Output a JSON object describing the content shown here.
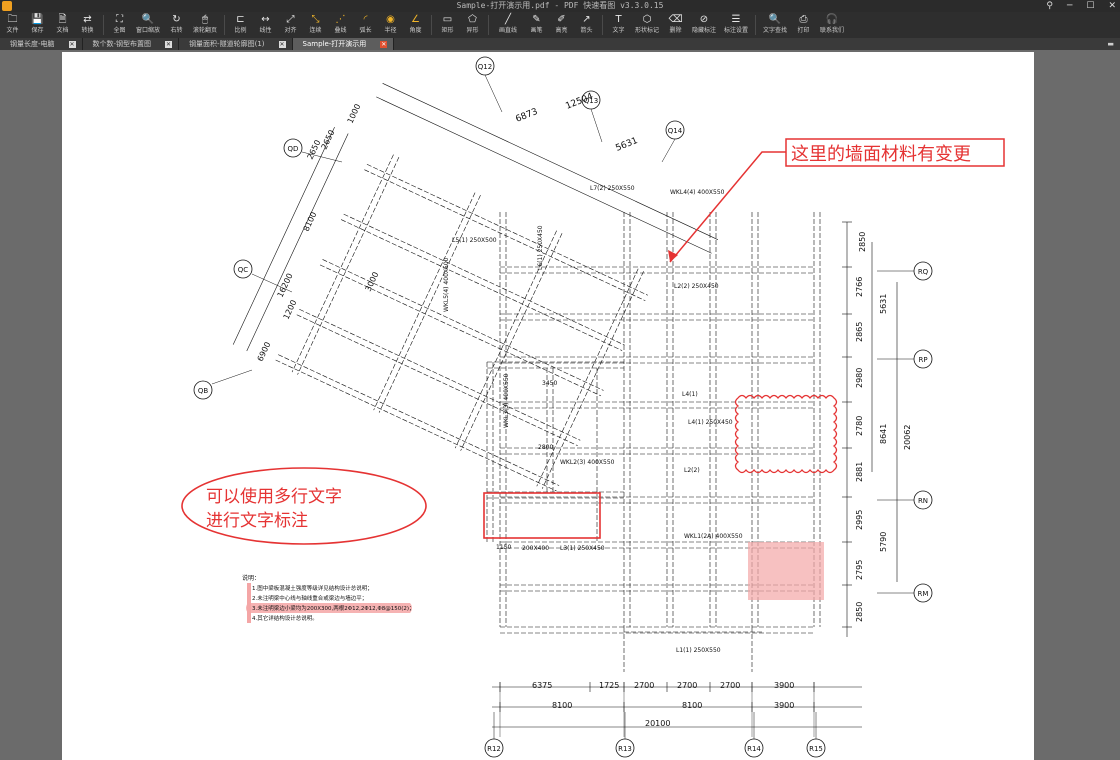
{
  "window": {
    "title": "Sample-打开演示用.pdf - PDF 快速看图 v3.3.0.15",
    "controls": [
      "⚲",
      "─",
      "☐",
      "✕"
    ]
  },
  "toolbar": [
    {
      "label": "文件",
      "icon": "folder-icon",
      "glyph": "🗀"
    },
    {
      "label": "保存",
      "icon": "save-icon",
      "glyph": "💾"
    },
    {
      "label": "文档",
      "icon": "document-icon",
      "glyph": "🗎"
    },
    {
      "label": "转换",
      "icon": "convert-icon",
      "glyph": "⇄"
    },
    {
      "label": "全图",
      "icon": "fit-all-icon",
      "glyph": "⛶"
    },
    {
      "label": "窗口缩放",
      "icon": "zoom-window-icon",
      "glyph": "🔍"
    },
    {
      "label": "右转",
      "icon": "rotate-right-icon",
      "glyph": "↻"
    },
    {
      "label": "滚轮翻页",
      "icon": "mouse-scroll-icon",
      "glyph": "🖱"
    },
    {
      "label": "比例",
      "icon": "scale-icon",
      "glyph": "⊏"
    },
    {
      "label": "线性",
      "icon": "linear-measure-icon",
      "glyph": "↔"
    },
    {
      "label": "对齐",
      "icon": "aligned-measure-icon",
      "glyph": "⤢"
    },
    {
      "label": "连续",
      "icon": "continuous-measure-icon",
      "glyph": "⤡"
    },
    {
      "label": "叠线",
      "icon": "overlay-line-icon",
      "glyph": "⋰"
    },
    {
      "label": "弧长",
      "icon": "arc-length-icon",
      "glyph": "◜"
    },
    {
      "label": "半径",
      "icon": "radius-icon",
      "glyph": "◉"
    },
    {
      "label": "角度",
      "icon": "angle-icon",
      "glyph": "∠"
    },
    {
      "label": "矩形",
      "icon": "rectangle-icon",
      "glyph": "▭"
    },
    {
      "label": "异形",
      "icon": "polygon-icon",
      "glyph": "⬠"
    },
    {
      "label": "画直线",
      "icon": "line-icon",
      "glyph": "╱"
    },
    {
      "label": "画笔",
      "icon": "pen-icon",
      "glyph": "✎"
    },
    {
      "label": "高亮",
      "icon": "highlight-icon",
      "glyph": "✐"
    },
    {
      "label": "箭头",
      "icon": "arrow-icon",
      "glyph": "↗"
    },
    {
      "label": "文字",
      "icon": "text-icon",
      "glyph": "T"
    },
    {
      "label": "形状标记",
      "icon": "shape-mark-icon",
      "glyph": "⬡"
    },
    {
      "label": "删除",
      "icon": "eraser-icon",
      "glyph": "⌫"
    },
    {
      "label": "隐藏标注",
      "icon": "hide-annotation-icon",
      "glyph": "⊘"
    },
    {
      "label": "标注设置",
      "icon": "annotation-settings-icon",
      "glyph": "☰"
    },
    {
      "label": "文字查找",
      "icon": "text-search-icon",
      "glyph": "🔍"
    },
    {
      "label": "打印",
      "icon": "print-icon",
      "glyph": "⎙"
    },
    {
      "label": "联系我们",
      "icon": "headset-icon",
      "glyph": "🎧"
    }
  ],
  "tabs": [
    {
      "label": "钢量长度-电脑",
      "active": false
    },
    {
      "label": "数个数-钢型布置图",
      "active": false
    },
    {
      "label": "钢量面积-隧道轮廓图(1)",
      "active": false
    },
    {
      "label": "Sample-打开演示用",
      "active": true
    }
  ],
  "tab_overflow": "▬",
  "drawing": {
    "axis_labels": [
      "Q12",
      "Q13",
      "Q14",
      "QD",
      "QC",
      "QB",
      "RQ",
      "RP",
      "RN",
      "RM",
      "R12",
      "R13",
      "R14",
      "R15"
    ],
    "dims_top": [
      "12504",
      "6873",
      "5631"
    ],
    "dims_left": [
      "2650",
      "2650",
      "1000",
      "8100",
      "16200",
      "1200",
      "6900",
      "3000"
    ],
    "dims_right": [
      "2850",
      "2766",
      "5631",
      "2865",
      "2980",
      "2780",
      "8641",
      "20062",
      "2881",
      "2995",
      "5790",
      "2795",
      "2850"
    ],
    "dims_bottom_row1": [
      "6375",
      "1725",
      "2700",
      "2700",
      "2700",
      "3900"
    ],
    "dims_bottom_row2": [
      "8100",
      "8100",
      "3900"
    ],
    "dims_bottom_total": "20100",
    "beam_labels": [
      {
        "t": "L7(2) 250X550"
      },
      {
        "t": "WKL4(4) 400X550"
      },
      {
        "t": "L5(1) 250X500"
      },
      {
        "t": "L6(1) 250X450"
      },
      {
        "t": "WKL5(4) 400X500"
      },
      {
        "t": "L2(2) 250X450"
      },
      {
        "t": "L4(1)"
      },
      {
        "t": "L4(1) 250X450"
      },
      {
        "t": "WKL2(3) 400X550"
      },
      {
        "t": "WKL3(3) 400X550"
      },
      {
        "t": "L2(2)"
      },
      {
        "t": "WKL1(2A) 400X550"
      },
      {
        "t": "L3(1) 250X450"
      },
      {
        "t": "200X400"
      },
      {
        "t": "L1(1) 250X550"
      },
      {
        "t": "2800"
      },
      {
        "t": "3450"
      },
      {
        "t": "1150"
      }
    ],
    "notes_title": "说明：",
    "notes": [
      "1.图中梁板混凝土强度等级详见结构设计总说明；",
      "2.未注明梁中心线与轴线重合或梁边与墙边平；",
      "3.未注明梁边小梁均为200X300,两根2Φ12,2Φ12,Φ8@150(2)；",
      "4.其它详结构设计总说明。"
    ],
    "annotations": {
      "callout_text": "这里的墙面材料有变更",
      "ellipse_text_line1": "可以使用多行文字",
      "ellipse_text_line2": "进行文字标注"
    }
  },
  "colors": {
    "accent": "#f0b429",
    "markup_red": "#e53333",
    "highlight_pink": "#f4a6a6"
  }
}
